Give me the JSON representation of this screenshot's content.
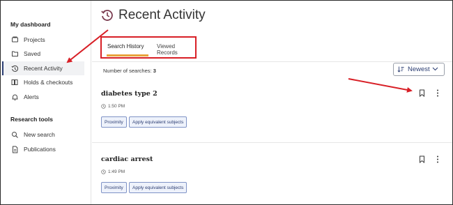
{
  "sidebar": {
    "dashboard_title": "My dashboard",
    "dashboard_items": [
      {
        "label": "Projects",
        "icon": "projects-icon"
      },
      {
        "label": "Saved",
        "icon": "saved-icon"
      },
      {
        "label": "Recent Activity",
        "icon": "history-icon",
        "active": true
      },
      {
        "label": "Holds & checkouts",
        "icon": "holds-icon"
      },
      {
        "label": "Alerts",
        "icon": "bell-icon"
      }
    ],
    "research_title": "Research tools",
    "research_items": [
      {
        "label": "New search",
        "icon": "search-icon"
      },
      {
        "label": "Publications",
        "icon": "publications-icon"
      }
    ]
  },
  "header": {
    "title": "Recent Activity"
  },
  "tabs": [
    {
      "label": "Search History",
      "active": true
    },
    {
      "label": "Viewed Records",
      "active": false
    }
  ],
  "count": {
    "label": "Number of searches:",
    "value": "3"
  },
  "sort": {
    "label": "Newest"
  },
  "searches": [
    {
      "title": "diabetes type 2",
      "time": "1:50 PM",
      "chips": [
        "Proximity",
        "Apply equivalent subjects"
      ]
    },
    {
      "title": "cardiac arrest",
      "time": "1:49 PM",
      "chips": [
        "Proximity",
        "Apply equivalent subjects"
      ]
    }
  ],
  "colors": {
    "accent": "#2c3e73",
    "tab_underline": "#e8a33b",
    "annotation_red": "#d81f26"
  }
}
